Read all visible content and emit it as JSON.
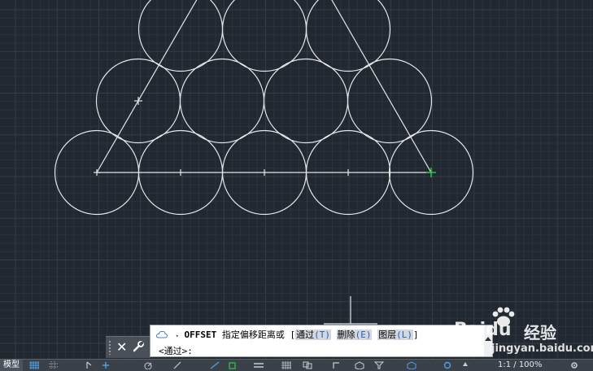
{
  "app": {
    "background": "#212830",
    "grid_minor": "#2a323c",
    "grid_major": "#343d48",
    "geometry_color": "#e6e6e6",
    "snap_marker_color": "#2ecc40"
  },
  "command_line": {
    "command": "OFFSET",
    "prompt": "指定偏移距离或",
    "bracket_open": "[",
    "bracket_close": "]",
    "options": [
      {
        "label": "通过",
        "key": "(T)"
      },
      {
        "label": "删除",
        "key": "(E)"
      },
      {
        "label": "图层",
        "key": "(L)"
      }
    ],
    "input_prompt": "<通过>:",
    "close_symbol": "✕"
  },
  "status_bar": {
    "model_tab": "模型",
    "zoom": "1:1 / 100%"
  },
  "watermark": {
    "brand": "Baidu",
    "product": "经验",
    "url": "jingyan.baidu.com"
  },
  "icons": [
    "cloud-icon",
    "wrench-icon",
    "close-icon",
    "grid-icon",
    "snap-icon",
    "ortho-icon",
    "polar-icon",
    "osnap-icon",
    "annotation-icon",
    "gear-icon"
  ]
}
